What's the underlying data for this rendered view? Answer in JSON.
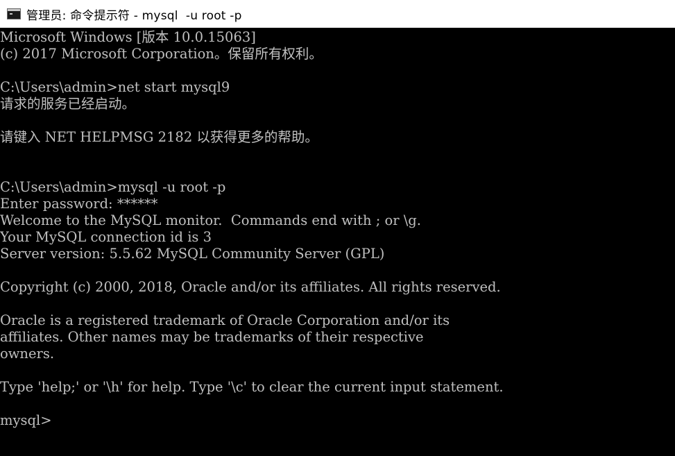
{
  "window": {
    "title": "管理员: 命令提示符 - mysql  -u root -p"
  },
  "console": {
    "lines": [
      "Microsoft Windows [版本 10.0.15063]",
      "(c) 2017 Microsoft Corporation。保留所有权利。",
      "",
      "C:\\Users\\admin>net start mysql9",
      "请求的服务已经启动。",
      "",
      "请键入 NET HELPMSG 2182 以获得更多的帮助。",
      "",
      "",
      "C:\\Users\\admin>mysql -u root -p",
      "Enter password: ******",
      "Welcome to the MySQL monitor.  Commands end with ; or \\g.",
      "Your MySQL connection id is 3",
      "Server version: 5.5.62 MySQL Community Server (GPL)",
      "",
      "Copyright (c) 2000, 2018, Oracle and/or its affiliates. All rights reserved.",
      "",
      "Oracle is a registered trademark of Oracle Corporation and/or its",
      "affiliates. Other names may be trademarks of their respective",
      "owners.",
      "",
      "Type 'help;' or '\\h' for help. Type '\\c' to clear the current input statement.",
      "",
      "mysql>"
    ]
  },
  "colors": {
    "background": "#000000",
    "text": "#c0c0c0",
    "titlebar": "#ffffff"
  },
  "icons": {
    "titlebar": "cmd-icon"
  }
}
